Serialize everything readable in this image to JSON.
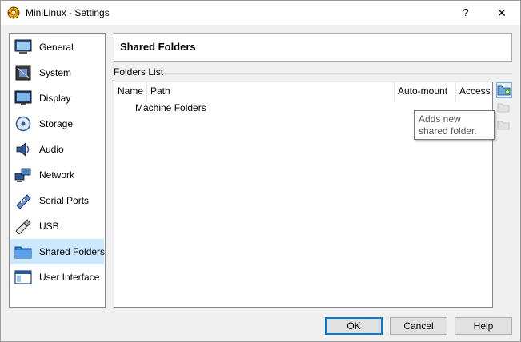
{
  "window": {
    "title": "MiniLinux - Settings",
    "help_label": "?",
    "close_label": "✕"
  },
  "sidebar": {
    "items": [
      {
        "label": "General",
        "icon": "monitor-icon"
      },
      {
        "label": "System",
        "icon": "chip-icon"
      },
      {
        "label": "Display",
        "icon": "display-icon"
      },
      {
        "label": "Storage",
        "icon": "disk-icon"
      },
      {
        "label": "Audio",
        "icon": "speaker-icon"
      },
      {
        "label": "Network",
        "icon": "network-icon"
      },
      {
        "label": "Serial Ports",
        "icon": "serial-port-icon"
      },
      {
        "label": "USB",
        "icon": "usb-icon"
      },
      {
        "label": "Shared Folders",
        "icon": "folder-icon",
        "selected": true
      },
      {
        "label": "User Interface",
        "icon": "window-icon"
      }
    ]
  },
  "header": {
    "title": "Shared Folders"
  },
  "folders_list": {
    "label": "Folders List",
    "columns": [
      "Name",
      "Path",
      "Auto-mount",
      "Access"
    ],
    "rows": [
      "Machine Folders"
    ]
  },
  "toolbar": {
    "tooltip": "Adds new shared folder."
  },
  "buttons": {
    "ok": "OK",
    "cancel": "Cancel",
    "help": "Help"
  },
  "colors": {
    "selection": "#cce8ff",
    "accent": "#0078d7"
  }
}
